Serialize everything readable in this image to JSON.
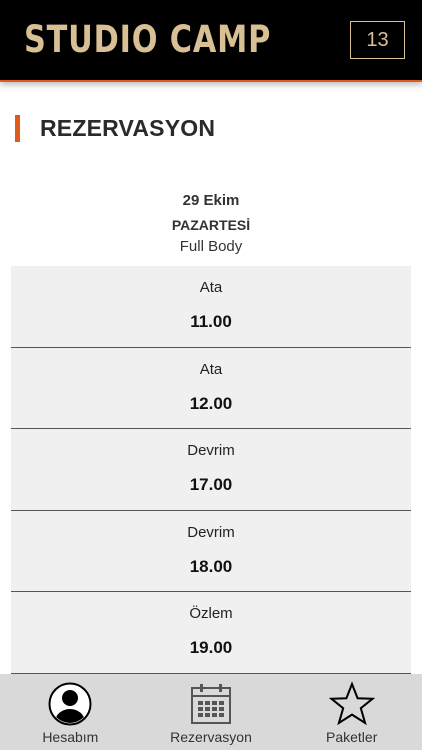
{
  "header": {
    "brand": "STUDIO CAMP",
    "counter": "13"
  },
  "page": {
    "title": "REZERVASYON"
  },
  "session": {
    "date": "29 Ekim",
    "day": "PAZARTESİ",
    "class_name": "Full Body"
  },
  "slots": [
    {
      "trainer": "Ata",
      "time": "11.00"
    },
    {
      "trainer": "Ata",
      "time": "12.00"
    },
    {
      "trainer": "Devrim",
      "time": "17.00"
    },
    {
      "trainer": "Devrim",
      "time": "18.00"
    },
    {
      "trainer": "Özlem",
      "time": "19.00"
    }
  ],
  "nav": {
    "items": [
      {
        "label": "Hesabım",
        "icon": "user-icon"
      },
      {
        "label": "Rezervasyon",
        "icon": "calendar-icon"
      },
      {
        "label": "Paketler",
        "icon": "star-icon"
      }
    ]
  },
  "colors": {
    "header_bg": "#000000",
    "brand": "#d8bf94",
    "accent": "#e05a1c",
    "slot_bg": "#f0f0f0",
    "nav_bg": "#d9d9d9"
  }
}
